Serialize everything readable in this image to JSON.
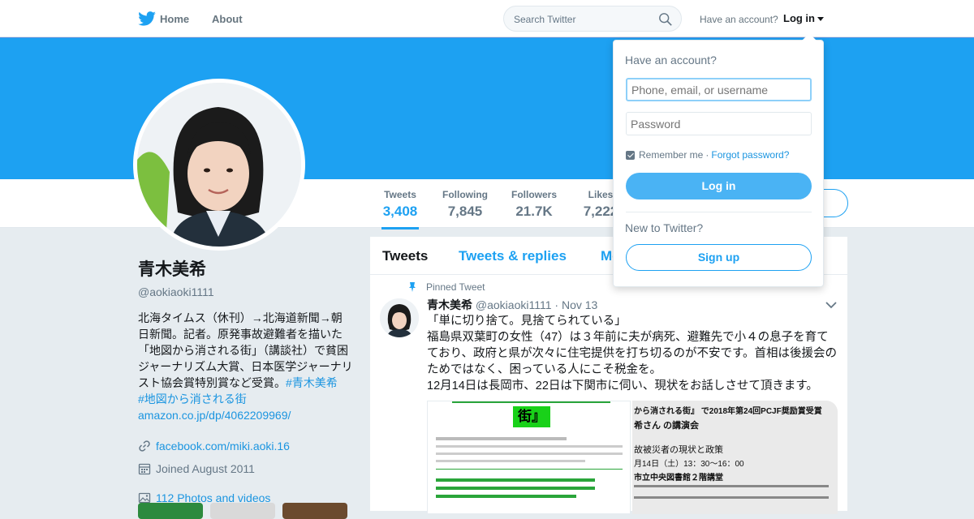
{
  "topbar": {
    "home_label": "Home",
    "about_label": "About",
    "search_placeholder": "Search Twitter",
    "have_account": "Have an account?",
    "login_label": "Log in"
  },
  "profile_nav": {
    "stats": [
      {
        "label": "Tweets",
        "value": "3,408"
      },
      {
        "label": "Following",
        "value": "7,845"
      },
      {
        "label": "Followers",
        "value": "21.7K"
      },
      {
        "label": "Likes",
        "value": "7,222"
      }
    ]
  },
  "profile": {
    "name": "青木美希",
    "handle": "@aokiaoki1111",
    "bio_text": "北海タイムス（休刊）→北海道新聞→朝日新聞。記者。原発事故避難者を描いた「地図から消される街」（講談社）で貧困ジャーナリズム大賞、日本医学ジャーナリスト協会賞特別賞など受賞。",
    "bio_tag1": "#青木美希",
    "bio_tag2": "#地図から消される街",
    "bio_link": "amazon.co.jp/dp/4062209969/",
    "website": "facebook.com/miki.aoki.16",
    "joined": "Joined August 2011",
    "photos": "112 Photos and videos"
  },
  "timeline": {
    "tabs": [
      "Tweets",
      "Tweets & replies",
      "Media"
    ],
    "pinned_label": "Pinned Tweet",
    "tweet": {
      "author": "青木美希",
      "handle": "@aokiaoki1111",
      "date": "Nov 13",
      "line1": "「単に切り捨て。見捨てられている」",
      "line2": "福島県双葉町の女性（47）は３年前に夫が病死、避難先で小４の息子を育てており、政府と県が次々に住宅提供を打ち切るのが不安です。首相は後援会のためではなく、困っている人にこそ税金を。",
      "line3": "12月14日は長岡市、22日は下関市に伺い、現状をお話しさせて頂きます。",
      "media1_text": "街』",
      "media2_line1": "から消される街』 で2018年第24回PCJF奨励賞受賞",
      "media2_line2": "希さん の講演会",
      "media2_line3": "故被災者の現状と政策",
      "media2_line4": "月14日（土）13：30～16：00",
      "media2_line5": "市立中央図書館２階講堂"
    }
  },
  "dropdown": {
    "title": "Have an account?",
    "username_placeholder": "Phone, email, or username",
    "password_placeholder": "Password",
    "remember": "Remember me",
    "forgot": "Forgot password?",
    "login_button": "Log in",
    "new_label": "New to Twitter?",
    "signup_button": "Sign up"
  },
  "colors": {
    "brand": "#1da1f2",
    "link": "#1b95e0",
    "muted": "#657786"
  }
}
